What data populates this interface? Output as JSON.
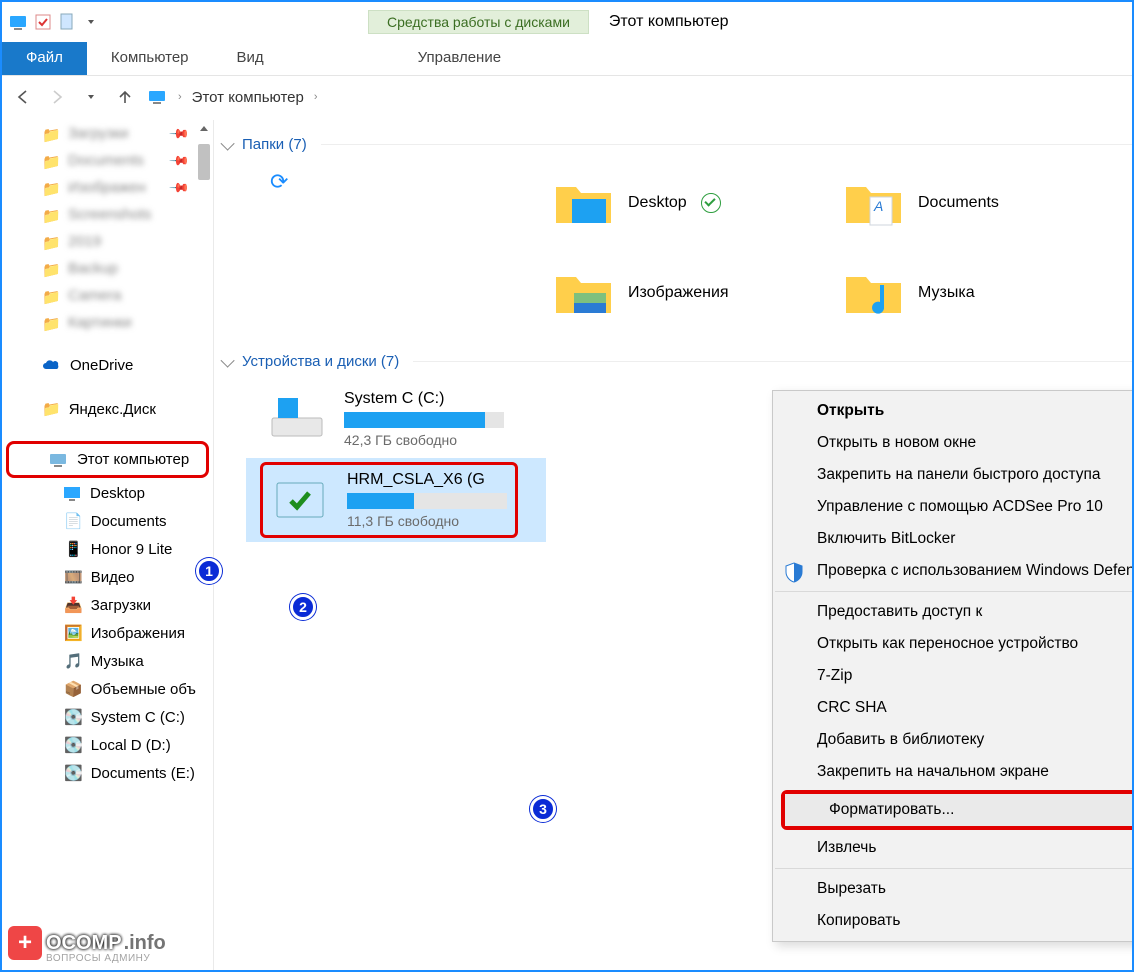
{
  "titlebar": {
    "drive_tools": "Средства работы с дисками",
    "title": "Этот компьютер"
  },
  "ribbon": {
    "file": "Файл",
    "computer": "Компьютер",
    "view": "Вид",
    "manage": "Управление"
  },
  "breadcrumb": {
    "root": "Этот компьютер"
  },
  "sidebar": {
    "blurred": [
      "Загрузки",
      "Documents",
      "Изображен",
      "Screenshots",
      "2019",
      "Backup",
      "Camera",
      "Картинки"
    ],
    "onedrive": "OneDrive",
    "yandex": "Яндекс.Диск",
    "this_pc": "Этот компьютер",
    "items": [
      "Desktop",
      "Documents",
      "Honor 9 Lite",
      "Видео",
      "Загрузки",
      "Изображения",
      "Музыка",
      "Объемные объ",
      "System C (C:)",
      "Local D (D:)",
      "Documents (E:)"
    ]
  },
  "sections": {
    "folders": "Папки (7)",
    "drives": "Устройства и диски (7)"
  },
  "folders": {
    "desktop": "Desktop",
    "documents": "Documents",
    "images": "Изображения",
    "music": "Музыка"
  },
  "drive_c": {
    "name": "System C (C:)",
    "free": "42,3 ГБ свободно",
    "fill_pct": 88
  },
  "drive_g": {
    "name": "HRM_CSLA_X6 (G",
    "free": "11,3 ГБ свободно",
    "fill_pct": 42
  },
  "ctx": {
    "open": "Открыть",
    "open_new": "Открыть в новом окне",
    "pin_quick": "Закрепить на панели быстрого доступа",
    "acdsee": "Управление с помощью ACDSee Pro 10",
    "bitlocker": "Включить BitLocker",
    "defender": "Проверка с использованием Windows Defender...",
    "share": "Предоставить доступ к",
    "portable": "Открыть как переносное устройство",
    "sevenzip": "7-Zip",
    "crc": "CRC SHA",
    "library": "Добавить в библиотеку",
    "pin_start": "Закрепить на начальном экране",
    "format": "Форматировать...",
    "eject": "Извлечь",
    "cut": "Вырезать",
    "copy": "Копировать"
  },
  "badges": {
    "b1": "1",
    "b2": "2",
    "b3": "3"
  },
  "watermark": {
    "brand": "OCOMP",
    "suffix": ".info",
    "sub": "ВОПРОСЫ АДМИНУ"
  }
}
